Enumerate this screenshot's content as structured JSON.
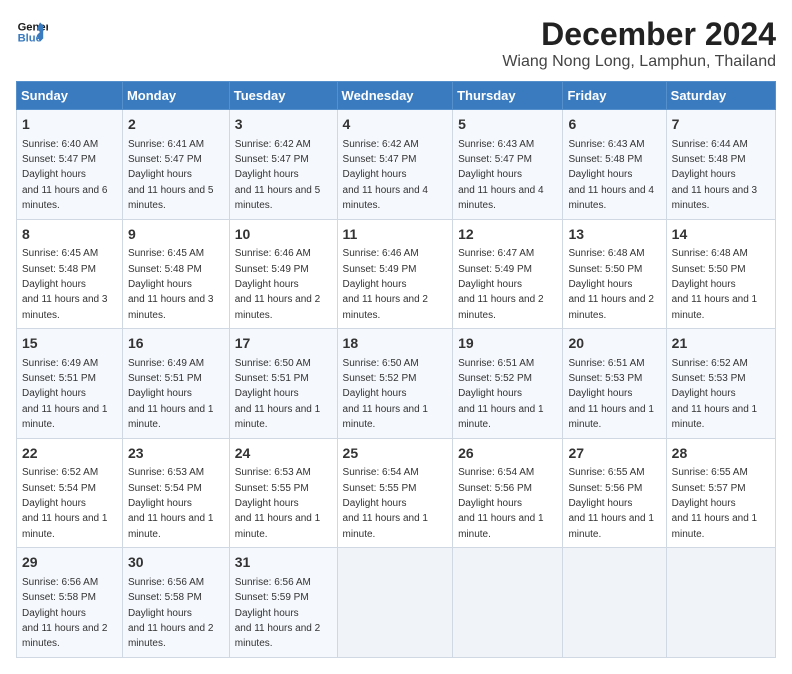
{
  "logo": {
    "line1": "General",
    "line2": "Blue"
  },
  "title": "December 2024",
  "location": "Wiang Nong Long, Lamphun, Thailand",
  "headers": [
    "Sunday",
    "Monday",
    "Tuesday",
    "Wednesday",
    "Thursday",
    "Friday",
    "Saturday"
  ],
  "weeks": [
    [
      {
        "day": "1",
        "sunrise": "6:40 AM",
        "sunset": "5:47 PM",
        "daylight": "11 hours and 6 minutes."
      },
      {
        "day": "2",
        "sunrise": "6:41 AM",
        "sunset": "5:47 PM",
        "daylight": "11 hours and 5 minutes."
      },
      {
        "day": "3",
        "sunrise": "6:42 AM",
        "sunset": "5:47 PM",
        "daylight": "11 hours and 5 minutes."
      },
      {
        "day": "4",
        "sunrise": "6:42 AM",
        "sunset": "5:47 PM",
        "daylight": "11 hours and 4 minutes."
      },
      {
        "day": "5",
        "sunrise": "6:43 AM",
        "sunset": "5:47 PM",
        "daylight": "11 hours and 4 minutes."
      },
      {
        "day": "6",
        "sunrise": "6:43 AM",
        "sunset": "5:48 PM",
        "daylight": "11 hours and 4 minutes."
      },
      {
        "day": "7",
        "sunrise": "6:44 AM",
        "sunset": "5:48 PM",
        "daylight": "11 hours and 3 minutes."
      }
    ],
    [
      {
        "day": "8",
        "sunrise": "6:45 AM",
        "sunset": "5:48 PM",
        "daylight": "11 hours and 3 minutes."
      },
      {
        "day": "9",
        "sunrise": "6:45 AM",
        "sunset": "5:48 PM",
        "daylight": "11 hours and 3 minutes."
      },
      {
        "day": "10",
        "sunrise": "6:46 AM",
        "sunset": "5:49 PM",
        "daylight": "11 hours and 2 minutes."
      },
      {
        "day": "11",
        "sunrise": "6:46 AM",
        "sunset": "5:49 PM",
        "daylight": "11 hours and 2 minutes."
      },
      {
        "day": "12",
        "sunrise": "6:47 AM",
        "sunset": "5:49 PM",
        "daylight": "11 hours and 2 minutes."
      },
      {
        "day": "13",
        "sunrise": "6:48 AM",
        "sunset": "5:50 PM",
        "daylight": "11 hours and 2 minutes."
      },
      {
        "day": "14",
        "sunrise": "6:48 AM",
        "sunset": "5:50 PM",
        "daylight": "11 hours and 1 minute."
      }
    ],
    [
      {
        "day": "15",
        "sunrise": "6:49 AM",
        "sunset": "5:51 PM",
        "daylight": "11 hours and 1 minute."
      },
      {
        "day": "16",
        "sunrise": "6:49 AM",
        "sunset": "5:51 PM",
        "daylight": "11 hours and 1 minute."
      },
      {
        "day": "17",
        "sunrise": "6:50 AM",
        "sunset": "5:51 PM",
        "daylight": "11 hours and 1 minute."
      },
      {
        "day": "18",
        "sunrise": "6:50 AM",
        "sunset": "5:52 PM",
        "daylight": "11 hours and 1 minute."
      },
      {
        "day": "19",
        "sunrise": "6:51 AM",
        "sunset": "5:52 PM",
        "daylight": "11 hours and 1 minute."
      },
      {
        "day": "20",
        "sunrise": "6:51 AM",
        "sunset": "5:53 PM",
        "daylight": "11 hours and 1 minute."
      },
      {
        "day": "21",
        "sunrise": "6:52 AM",
        "sunset": "5:53 PM",
        "daylight": "11 hours and 1 minute."
      }
    ],
    [
      {
        "day": "22",
        "sunrise": "6:52 AM",
        "sunset": "5:54 PM",
        "daylight": "11 hours and 1 minute."
      },
      {
        "day": "23",
        "sunrise": "6:53 AM",
        "sunset": "5:54 PM",
        "daylight": "11 hours and 1 minute."
      },
      {
        "day": "24",
        "sunrise": "6:53 AM",
        "sunset": "5:55 PM",
        "daylight": "11 hours and 1 minute."
      },
      {
        "day": "25",
        "sunrise": "6:54 AM",
        "sunset": "5:55 PM",
        "daylight": "11 hours and 1 minute."
      },
      {
        "day": "26",
        "sunrise": "6:54 AM",
        "sunset": "5:56 PM",
        "daylight": "11 hours and 1 minute."
      },
      {
        "day": "27",
        "sunrise": "6:55 AM",
        "sunset": "5:56 PM",
        "daylight": "11 hours and 1 minute."
      },
      {
        "day": "28",
        "sunrise": "6:55 AM",
        "sunset": "5:57 PM",
        "daylight": "11 hours and 1 minute."
      }
    ],
    [
      {
        "day": "29",
        "sunrise": "6:56 AM",
        "sunset": "5:58 PM",
        "daylight": "11 hours and 2 minutes."
      },
      {
        "day": "30",
        "sunrise": "6:56 AM",
        "sunset": "5:58 PM",
        "daylight": "11 hours and 2 minutes."
      },
      {
        "day": "31",
        "sunrise": "6:56 AM",
        "sunset": "5:59 PM",
        "daylight": "11 hours and 2 minutes."
      },
      null,
      null,
      null,
      null
    ]
  ]
}
